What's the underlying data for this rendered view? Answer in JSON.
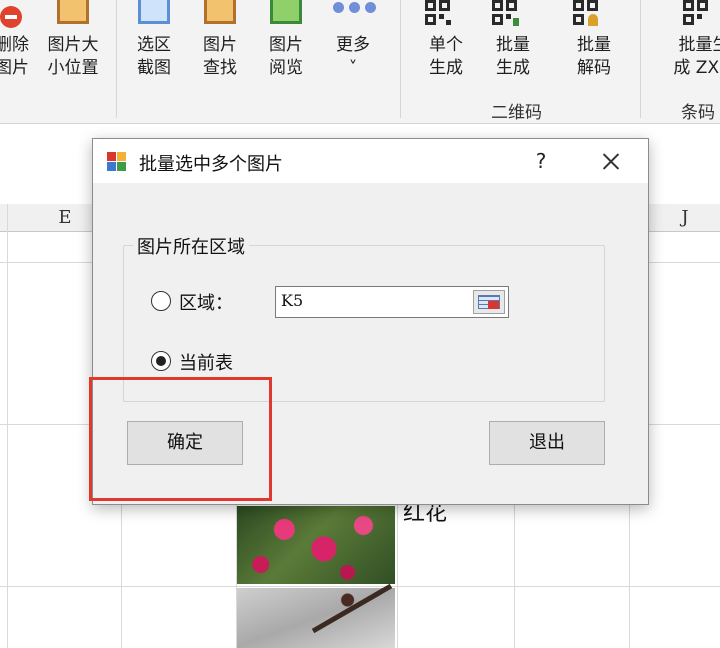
{
  "ribbon": {
    "buttons": [
      {
        "label": "删除\n图片",
        "icon": "delete-picture-icon"
      },
      {
        "label": "图片大\n小位置",
        "icon": "picture-size-icon"
      },
      {
        "label": "选区\n截图",
        "icon": "screenshot-icon"
      },
      {
        "label": "图片\n查找",
        "icon": "picture-find-icon"
      },
      {
        "label": "图片\n阅览",
        "icon": "picture-view-icon"
      },
      {
        "label": "更多\n˅",
        "icon": "more-dots-icon"
      },
      {
        "label": "单个\n生成",
        "icon": "qr-code-icon"
      },
      {
        "label": "批量\n生成",
        "icon": "qr-batch-icon"
      },
      {
        "label": "批量\n解码",
        "icon": "qr-decode-icon"
      },
      {
        "label": "批量生\n成 ZXin",
        "icon": "barcode-icon"
      }
    ],
    "groups": {
      "qr": "二维码",
      "barcode": "条码"
    }
  },
  "sheet": {
    "columns": [
      "E",
      "J"
    ],
    "cell_text": "红花"
  },
  "dialog": {
    "title": "批量选中多个图片",
    "help": "?",
    "group_title": "图片所在区域",
    "radio_range_label": "区域：",
    "radio_range_checked": false,
    "range_value": "K5",
    "radio_sheet_label": "当前表",
    "radio_sheet_checked": true,
    "ok_label": "确定",
    "exit_label": "退出"
  },
  "colors": {
    "highlight": "#e2372e",
    "dialog_bg": "#f0f0f0"
  }
}
